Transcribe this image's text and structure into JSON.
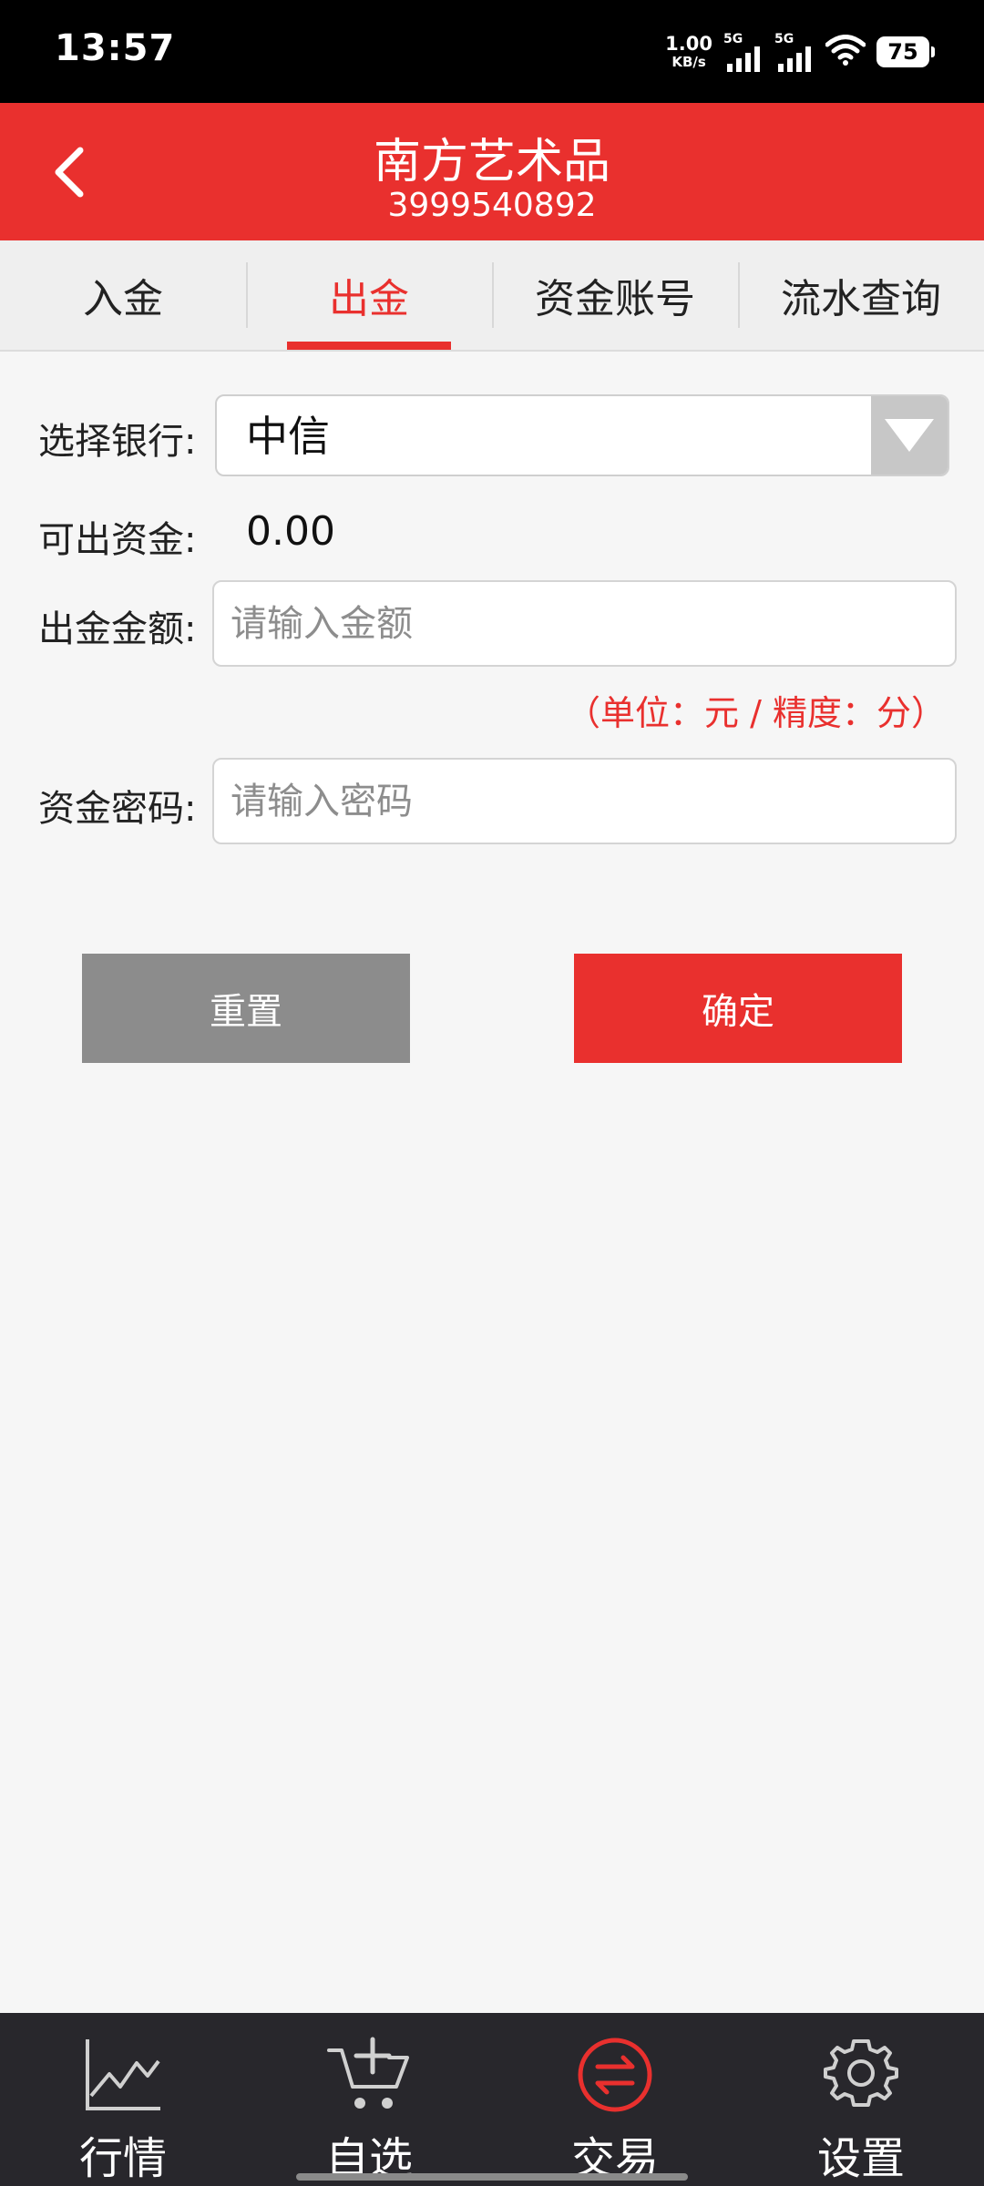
{
  "status_bar": {
    "time": "13:57",
    "net_speed_value": "1.00",
    "net_speed_unit": "KB/s",
    "signal1_label": "5G",
    "signal2_label": "5G",
    "battery": "75"
  },
  "header": {
    "title": "南方艺术品",
    "subtitle": "3999540892"
  },
  "tabs": [
    {
      "label": "入金",
      "active": false
    },
    {
      "label": "出金",
      "active": true
    },
    {
      "label": "资金账号",
      "active": false
    },
    {
      "label": "流水查询",
      "active": false
    }
  ],
  "form": {
    "bank_label": "选择银行:",
    "bank_selected": "中信",
    "funds_label": "可出资金:",
    "funds_value": "0.00",
    "amount_label": "出金金额:",
    "amount_placeholder": "请输入金额",
    "unit_note": "（单位：元 / 精度：分）",
    "password_label": "资金密码:",
    "password_placeholder": "请输入密码"
  },
  "buttons": {
    "reset": "重置",
    "confirm": "确定"
  },
  "bottom_nav": [
    {
      "label": "行情",
      "icon": "chart-icon",
      "active": false
    },
    {
      "label": "自选",
      "icon": "cart-add-icon",
      "active": false
    },
    {
      "label": "交易",
      "icon": "exchange-icon",
      "active": true
    },
    {
      "label": "设置",
      "icon": "gear-icon",
      "active": false
    }
  ],
  "colors": {
    "accent": "#e9302e",
    "nav_bg": "#28272c",
    "reset_button": "#8c8c8c"
  }
}
